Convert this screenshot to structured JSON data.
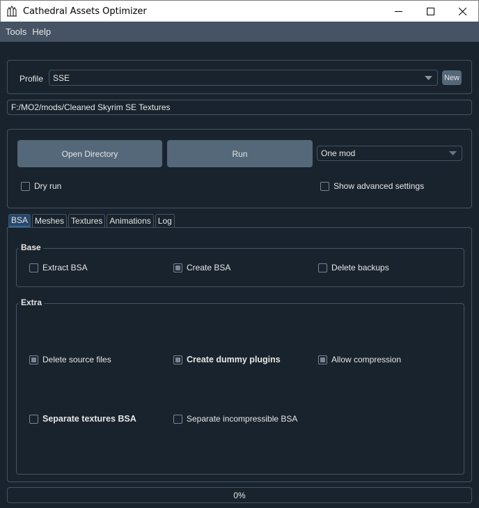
{
  "window": {
    "title": "Cathedral Assets Optimizer"
  },
  "menu": {
    "items": [
      "Tools",
      "Help"
    ]
  },
  "profile": {
    "label": "Profile",
    "value": "SSE",
    "new_label": "New"
  },
  "path": {
    "value": "F:/MO2/mods/Cleaned Skyrim SE Textures"
  },
  "actions": {
    "open_directory": "Open Directory",
    "run": "Run",
    "mode": "One mod",
    "dry_run": "Dry run",
    "show_advanced": "Show advanced settings"
  },
  "tabs": [
    "BSA",
    "Meshes",
    "Textures",
    "Animations",
    "Log"
  ],
  "bsa": {
    "base": {
      "title": "Base",
      "extract": "Extract BSA",
      "create": "Create BSA",
      "delete_backups": "Delete backups"
    },
    "extra": {
      "title": "Extra",
      "delete_source": "Delete source files",
      "create_dummy": "Create dummy plugins",
      "allow_compression": "Allow compression",
      "separate_textures": "Separate textures BSA",
      "separate_incompressible": "Separate incompressible BSA"
    }
  },
  "progress": {
    "value": 0,
    "text": "0%"
  }
}
